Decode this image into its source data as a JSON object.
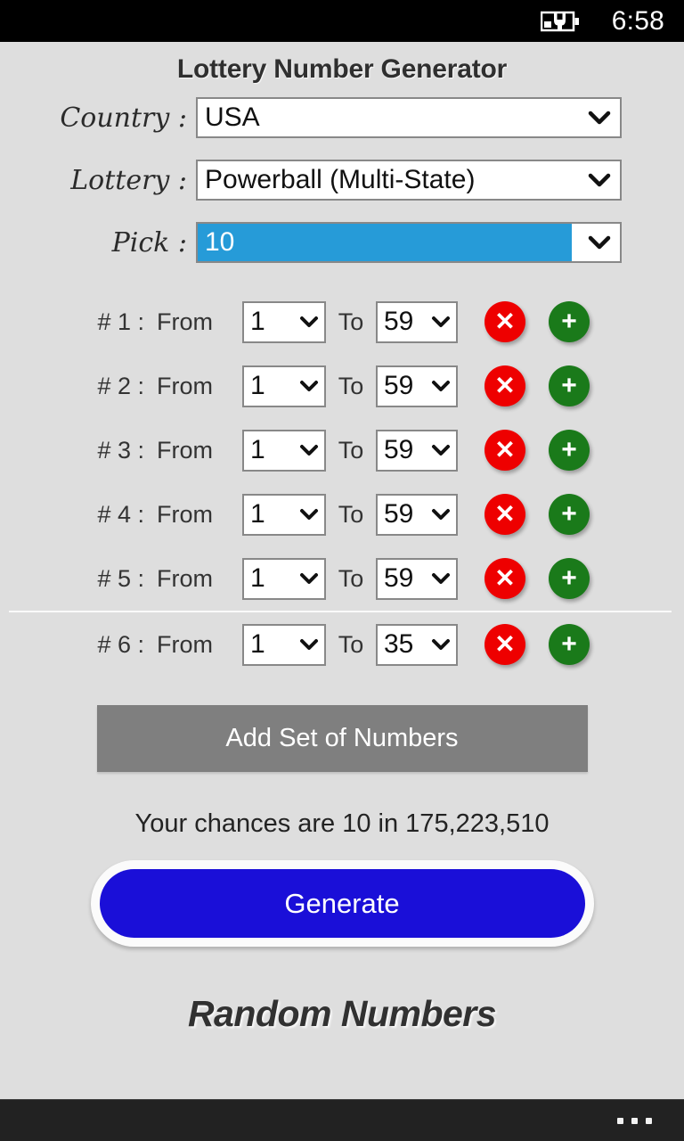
{
  "status_bar": {
    "battery_icon": "battery-charging-icon",
    "time": "6:58"
  },
  "app": {
    "title": "Lottery Number Generator"
  },
  "selectors": [
    {
      "label": "Country :",
      "value": "USA",
      "name": "country",
      "highlighted": false,
      "caret_icon": "chevron-down-icon"
    },
    {
      "label": "Lottery :",
      "value": "Powerball (Multi-State)",
      "name": "lottery",
      "highlighted": false,
      "caret_icon": "chevron-down-icon"
    },
    {
      "label": "Pick :",
      "value": "10",
      "name": "pick",
      "highlighted": true,
      "caret_icon": "chevron-down-icon"
    }
  ],
  "range_rows": {
    "from_label": "From",
    "to_label": "To",
    "delete_icon": "x-icon",
    "add_icon": "plus-icon",
    "caret_icon": "chevron-down-icon",
    "rows": [
      {
        "index_label": "# 1 :",
        "from": "1",
        "to": "59"
      },
      {
        "index_label": "# 2 :",
        "from": "1",
        "to": "59"
      },
      {
        "index_label": "# 3 :",
        "from": "1",
        "to": "59"
      },
      {
        "index_label": "# 4 :",
        "from": "1",
        "to": "59"
      },
      {
        "index_label": "# 5 :",
        "from": "1",
        "to": "59"
      },
      {
        "index_label": "# 6 :",
        "from": "1",
        "to": "35"
      }
    ]
  },
  "actions": {
    "add_set_label": "Add Set of Numbers",
    "chances_text": "Your chances are 10 in 175,223,510",
    "generate_label": "Generate"
  },
  "results": {
    "heading": "Random Numbers",
    "numbers": ""
  },
  "nav_bar": {
    "more_icon": "ellipsis-icon"
  },
  "colors": {
    "page_background": "#dedede",
    "status_bar": "#000000",
    "nav_bar": "#222222",
    "highlight_blue": "#269bd8",
    "generate_blue": "#1a0fd8",
    "delete_red": "#ee0000",
    "add_green": "#1a7a1a",
    "add_set_gray": "#7f7f7f",
    "title_gray": "#2f2f2f"
  }
}
